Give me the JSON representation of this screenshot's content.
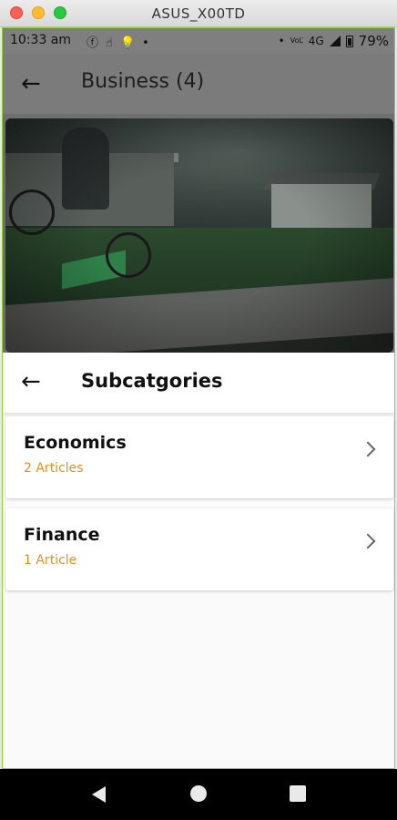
{
  "window": {
    "title": "ASUS_X00TD"
  },
  "status_bar": {
    "time": "10:33 am",
    "left_icons": [
      "facebook-icon",
      "touch-icon",
      "lightbulb-icon",
      "dot-icon"
    ],
    "network": "4G",
    "volte": "VoLTE",
    "battery_percent": "79%"
  },
  "app_bar": {
    "title": "Business (4)",
    "back_icon": "arrow-left-icon"
  },
  "sheet": {
    "title": "Subcatgories",
    "back_icon": "arrow-left-icon",
    "items": [
      {
        "title": "Economics",
        "subtitle": "2 Articles",
        "chevron": "chevron-right-icon"
      },
      {
        "title": "Finance",
        "subtitle": "1 Article",
        "chevron": "chevron-right-icon"
      }
    ]
  },
  "nav_bar": {
    "back_icon": "nav-back-icon",
    "home_icon": "nav-home-icon",
    "recents_icon": "nav-recents-icon"
  },
  "colors": {
    "accent": "#e7911e",
    "frame": "#8fd12f"
  }
}
